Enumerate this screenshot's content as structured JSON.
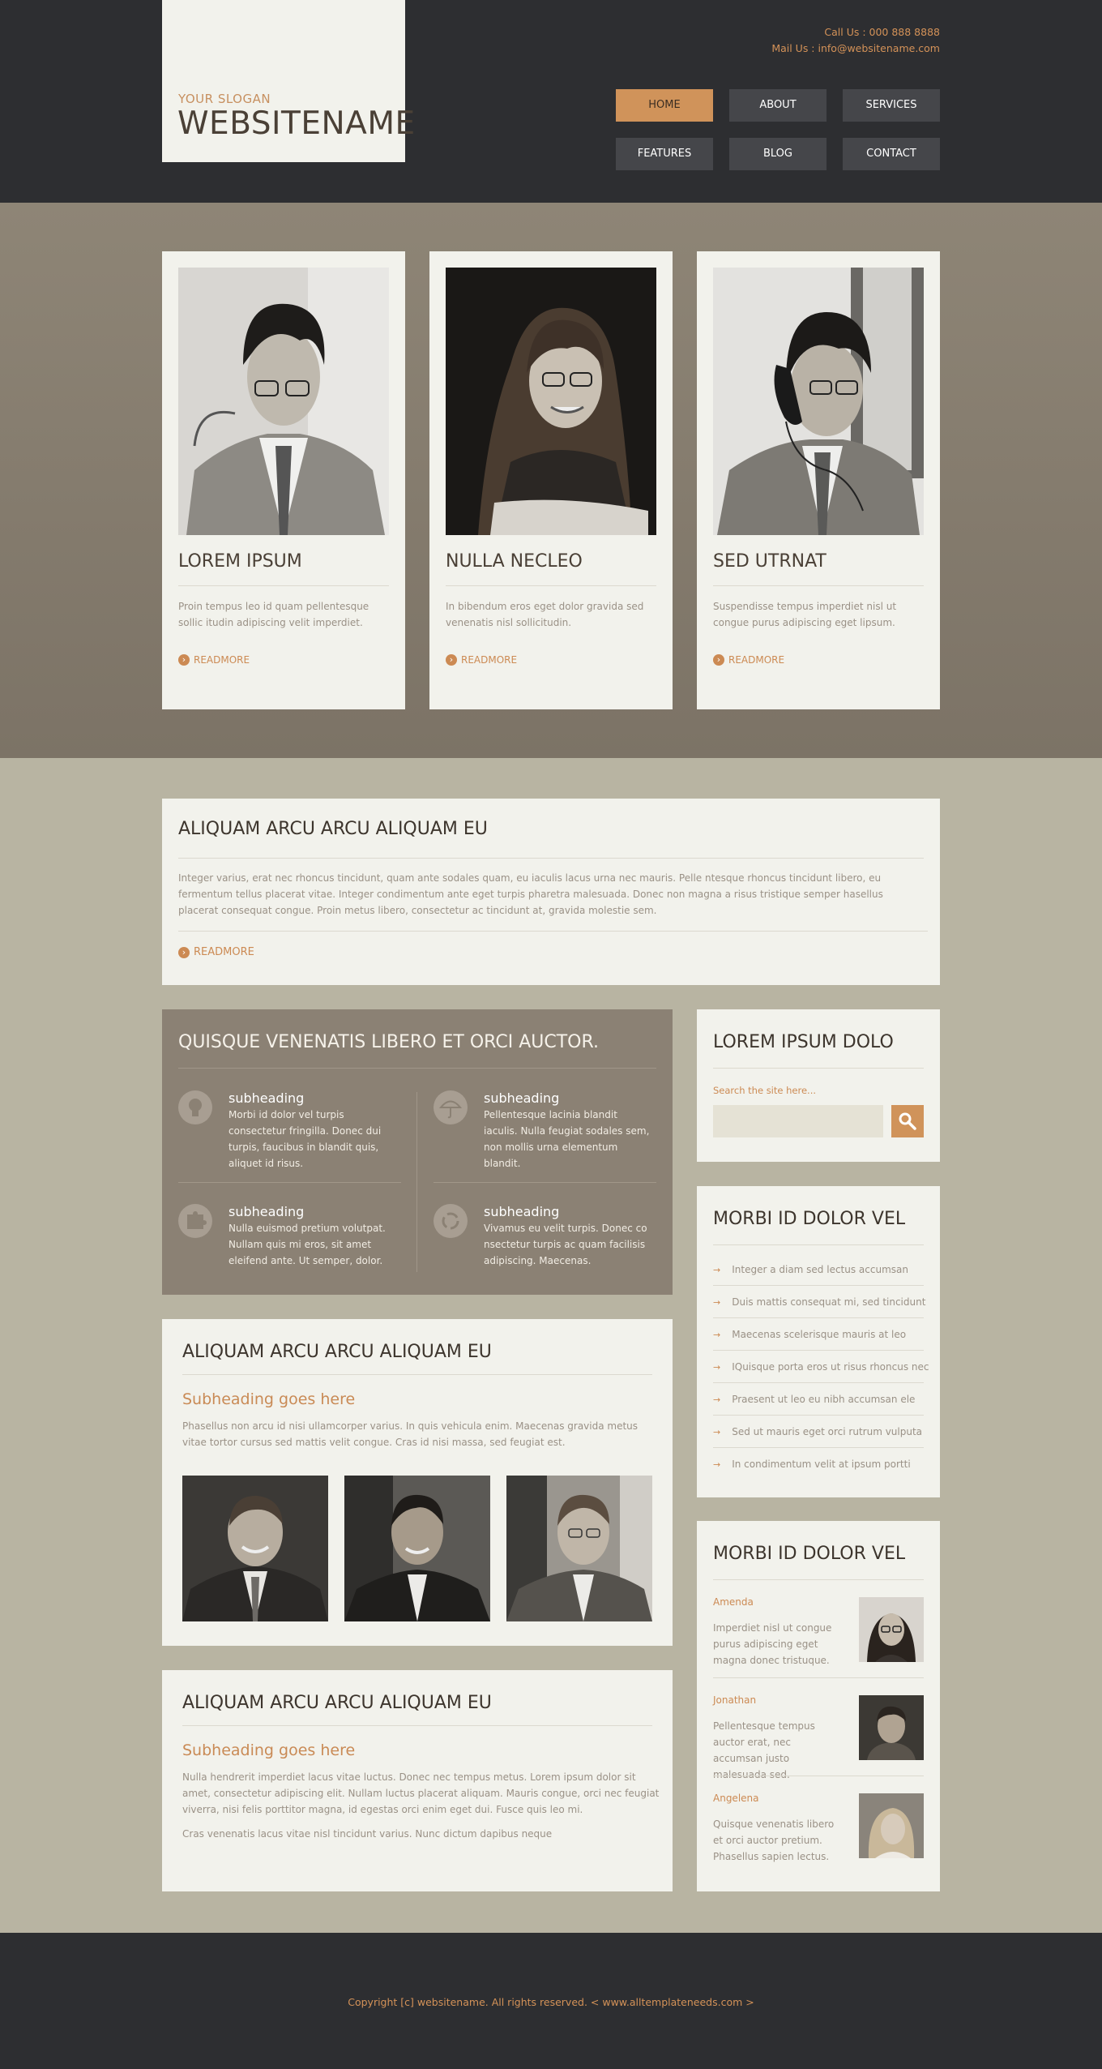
{
  "header": {
    "slogan": "YOUR SLOGAN",
    "site_name": "WEBSITENAME",
    "call": "Call Us : 000 888 8888",
    "mail": "Mail Us : info@websitename.com",
    "nav": [
      "HOME",
      "ABOUT",
      "SERVICES",
      "FEATURES",
      "BLOG",
      "CONTACT"
    ],
    "active_nav": "HOME"
  },
  "team": [
    {
      "title": "LOREM IPSUM",
      "text": "Proin tempus leo id quam pellentesque sollic itudin adipiscing velit imperdiet.",
      "readmore": "READMORE"
    },
    {
      "title": "NULLA NECLEO",
      "text": "In bibendum eros eget dolor gravida sed venenatis nisl sollicitudin.",
      "readmore": "READMORE"
    },
    {
      "title": "SED UTRNAT",
      "text": "Suspendisse tempus imperdiet nisl ut congue purus adipiscing eget lipsum.",
      "readmore": "READMORE"
    }
  ],
  "intro": {
    "title": "ALIQUAM ARCU ARCU ALIQUAM EU",
    "text": "Integer varius, erat nec rhoncus tincidunt, quam ante sodales quam, eu iaculis lacus urna nec mauris. Pelle ntesque rhoncus tincidunt libero, eu fermentum tellus placerat vitae. Integer condimentum ante eget turpis pharetra malesuada. Donec non magna a risus tristique semper hasellus placerat consequat congue. Proin metus libero, consectetur ac tincidunt at, gravida molestie sem.",
    "readmore": "READMORE"
  },
  "features": {
    "title": "QUISQUE VENENATIS LIBERO ET ORCI AUCTOR.",
    "items": [
      {
        "icon": "lightbulb-icon",
        "heading": "subheading",
        "text": "Morbi id dolor vel turpis consectetur fringilla. Donec dui turpis, faucibus in blandit quis, aliquet id risus."
      },
      {
        "icon": "umbrella-icon",
        "heading": "subheading",
        "text": "Pellentesque lacinia blandit iaculis. Nulla feugiat sodales sem, non mollis urna elementum blandit."
      },
      {
        "icon": "puzzle-icon",
        "heading": "subheading",
        "text": "Nulla euismod pretium volutpat. Nullam quis mi eros, sit amet eleifend ante. Ut semper, dolor."
      },
      {
        "icon": "recycle-icon",
        "heading": "subheading",
        "text": "Vivamus eu velit turpis. Donec co nsectetur turpis ac quam facilisis adipiscing. Maecenas."
      }
    ]
  },
  "article1": {
    "title": "ALIQUAM ARCU ARCU ALIQUAM EU",
    "subheading": "Subheading goes here",
    "text": "Phasellus non arcu id nisi ullamcorper varius. In quis vehicula enim. Maecenas gravida metus vitae tortor cursus sed mattis velit congue. Cras id nisi massa, sed feugiat est."
  },
  "article2": {
    "title": "ALIQUAM ARCU ARCU ALIQUAM EU",
    "subheading": "Subheading goes here",
    "text": "Nulla hendrerit imperdiet lacus vitae luctus. Donec nec tempus metus. Lorem ipsum dolor sit amet, consectetur adipiscing elit. Nullam luctus placerat aliquam. Mauris congue, orci nec feugiat viverra, nisi felis porttitor magna, id egestas orci enim eget dui. Fusce quis leo mi.",
    "text2": "Cras venenatis lacus vitae nisl tincidunt varius. Nunc dictum dapibus neque"
  },
  "search": {
    "title": "LOREM IPSUM DOLO",
    "label": "Search the site here...",
    "placeholder": ""
  },
  "list_box": {
    "title": "MORBI ID DOLOR VEL",
    "items": [
      "Integer a diam sed lectus accumsan",
      "Duis mattis consequat mi, sed tincidunt",
      "Maecenas scelerisque mauris at leo",
      "IQuisque porta eros ut risus rhoncus nec",
      "Praesent ut leo eu nibh accumsan ele",
      "Sed ut mauris eget orci rutrum vulputa",
      "In condimentum velit at ipsum portti"
    ]
  },
  "people_box": {
    "title": "MORBI ID DOLOR VEL",
    "people": [
      {
        "name": "Amenda",
        "text": "Imperdiet nisl ut congue purus adipiscing eget magna donec tristuque."
      },
      {
        "name": "Jonathan",
        "text": "Pellentesque tempus auctor erat, nec accumsan justo malesuada sed."
      },
      {
        "name": "Angelena",
        "text": "Quisque venenatis libero et orci auctor pretium. Phasellus sapien lectus."
      }
    ]
  },
  "footer": {
    "copyright": "Copyright  [c]  websitename. All rights reserved. < www.alltemplateneeds.com >"
  }
}
